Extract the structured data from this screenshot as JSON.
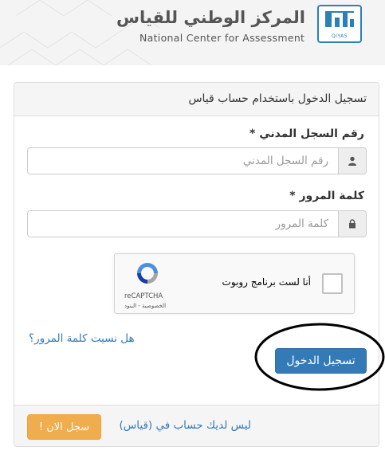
{
  "header": {
    "title_ar": "المركز الوطني للقياس",
    "title_en": "National Center for Assessment",
    "logo_text": "QIYAS",
    "logo_icon": "qiyas-logo-icon"
  },
  "login": {
    "heading": "تسجيل الدخول باستخدام حساب قياس",
    "national_id": {
      "label": "رقم السجل المدني",
      "required_mark": "*",
      "placeholder": "رقم السجل المدني",
      "value": "",
      "icon": "user-icon"
    },
    "password": {
      "label": "كلمة المرور",
      "required_mark": "*",
      "placeholder": "كلمة المرور",
      "value": "",
      "icon": "lock-icon"
    },
    "recaptcha": {
      "label": "أنا لست برنامج روبوت",
      "brand": "reCAPTCHA",
      "links": "الخصوصية - البنود",
      "icon": "recaptcha-icon"
    },
    "forgot_password": "هل نسيت كلمة المرور؟",
    "submit_label": "تسجيل الدخول"
  },
  "footer": {
    "no_account_text": "ليس لديك حساب في (قياس)",
    "signup_label": "سجل الان !"
  },
  "colors": {
    "primary": "#337ab7",
    "warning": "#f0ad4e",
    "brand_blue": "#2d7fb8"
  }
}
